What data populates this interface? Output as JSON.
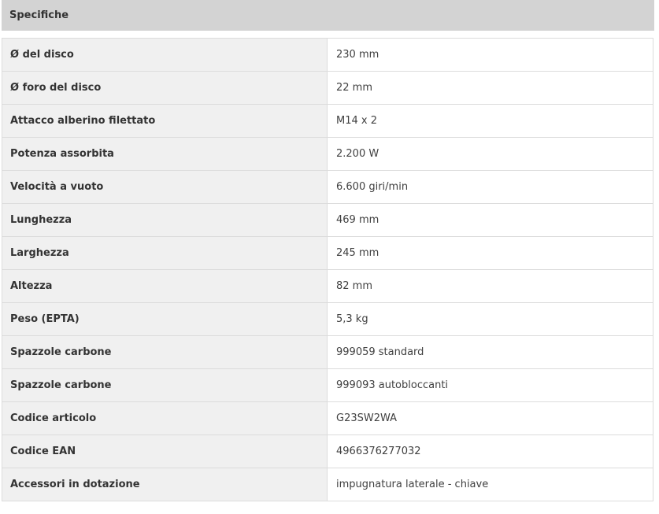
{
  "header": {
    "title": "Specifiche"
  },
  "specs": [
    {
      "label": "Ø del disco",
      "value": "230 mm"
    },
    {
      "label": "Ø foro del disco",
      "value": "22 mm"
    },
    {
      "label": "Attacco alberino filettato",
      "value": "M14 x 2"
    },
    {
      "label": "Potenza assorbita",
      "value": "2.200 W"
    },
    {
      "label": "Velocità a vuoto",
      "value": "6.600 giri/min"
    },
    {
      "label": "Lunghezza",
      "value": "469 mm"
    },
    {
      "label": "Larghezza",
      "value": "245 mm"
    },
    {
      "label": "Altezza",
      "value": "82 mm"
    },
    {
      "label": "Peso (EPTA)",
      "value": "5,3 kg"
    },
    {
      "label": "Spazzole carbone",
      "value": "999059 standard"
    },
    {
      "label": "Spazzole carbone",
      "value": "999093 autobloccanti"
    },
    {
      "label": "Codice articolo",
      "value": "G23SW2WA"
    },
    {
      "label": "Codice EAN",
      "value": "4966376277032"
    },
    {
      "label": "Accessori in dotazione",
      "value": "impugnatura laterale - chiave"
    }
  ]
}
